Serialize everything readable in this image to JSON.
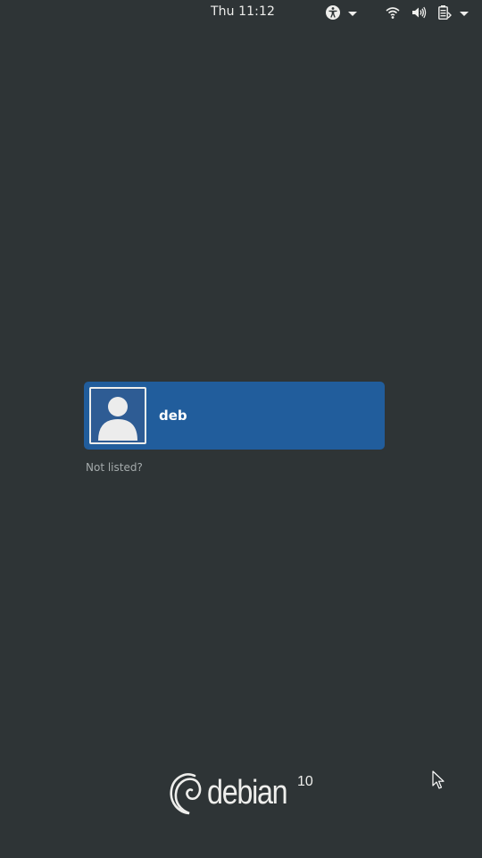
{
  "top_bar": {
    "clock": "Thu 11:12",
    "accessibility_icon": "accessibility-icon",
    "system_icons": [
      "wifi-icon",
      "volume-icon",
      "battery-icon"
    ]
  },
  "user_list": {
    "users": [
      {
        "name": "deb",
        "avatar_icon": "user-avatar-icon"
      }
    ],
    "not_listed": "Not listed?"
  },
  "branding": {
    "name": "debian",
    "version": "10"
  },
  "colors": {
    "background": "#2e3436",
    "selected_user": "#215d9c",
    "text": "#eeeeec",
    "muted_text": "#a4aaab"
  }
}
